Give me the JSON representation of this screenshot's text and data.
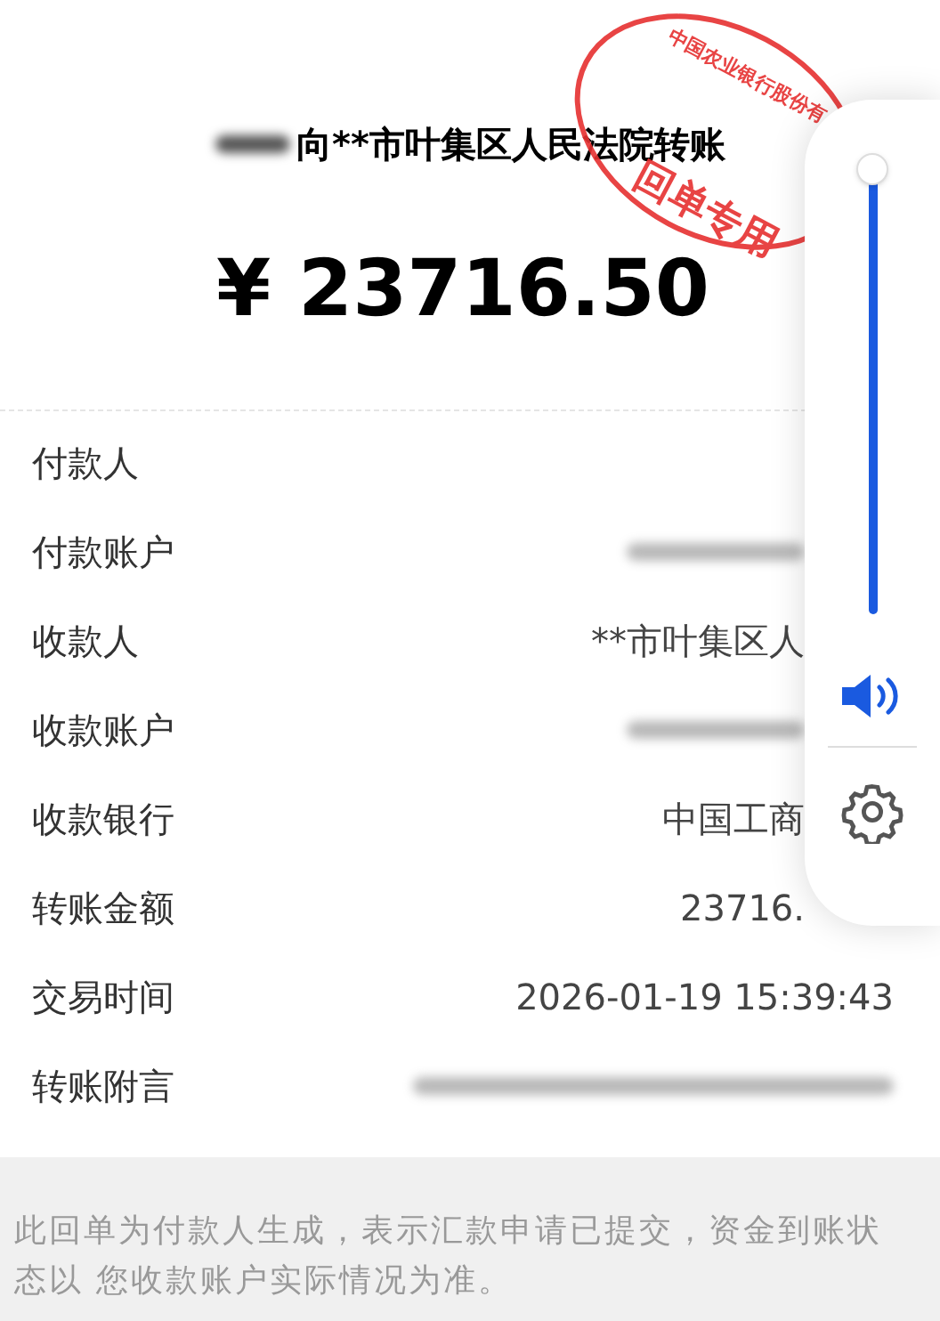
{
  "header": {
    "title": "向**市叶集区人民法院转账",
    "amount": "¥ 23716.50"
  },
  "stamp": {
    "outer": "中国农业银行股份有",
    "center": "回单专用"
  },
  "rows": [
    {
      "label": "付款人",
      "kind": "blank"
    },
    {
      "label": "付款账户",
      "kind": "redacted"
    },
    {
      "label": "收款人",
      "kind": "text",
      "value": "**市叶集区人"
    },
    {
      "label": "收款账户",
      "kind": "redacted"
    },
    {
      "label": "收款银行",
      "kind": "text",
      "value": "中国工商"
    },
    {
      "label": "转账金额",
      "kind": "text",
      "value": "23716."
    },
    {
      "label": "交易时间",
      "kind": "text",
      "value": "2026-01-19 15:39:43"
    },
    {
      "label": "转账附言",
      "kind": "redacted_wide"
    }
  ],
  "volume_panel": {
    "level": 1
  },
  "footer": {
    "note": "此回单为付款人生成，表示汇款申请已提交，资金到账状态以 您收款账户实际情况为准。"
  }
}
